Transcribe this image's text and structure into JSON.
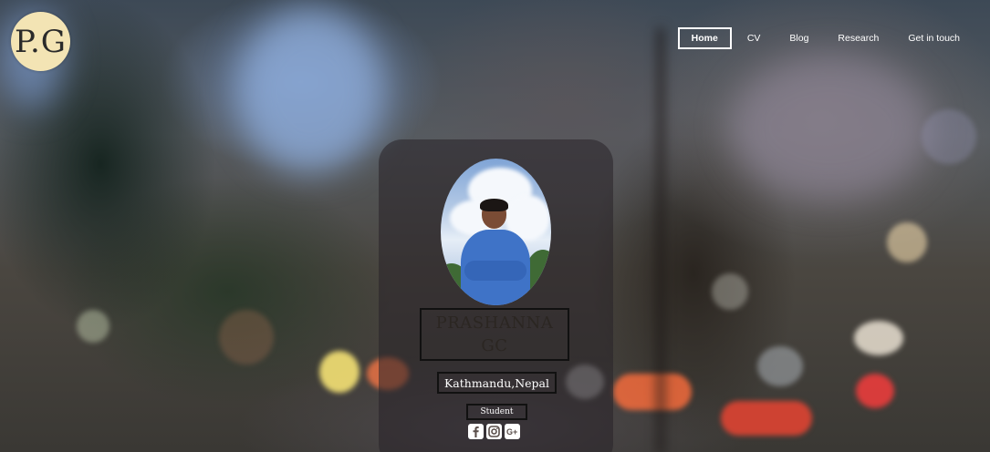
{
  "logo": {
    "text": "P.G"
  },
  "nav": {
    "items": [
      {
        "label": "Home",
        "active": true
      },
      {
        "label": "CV",
        "active": false
      },
      {
        "label": "Blog",
        "active": false
      },
      {
        "label": "Research",
        "active": false
      },
      {
        "label": "Get in touch",
        "active": false
      }
    ]
  },
  "profile": {
    "name_line1": "PRASHANNA",
    "name_line2": "GC",
    "location": "Kathmandu,Nepal",
    "role": "Student"
  },
  "socials": [
    {
      "icon": "facebook-icon",
      "glyph": "f"
    },
    {
      "icon": "instagram-icon",
      "glyph": "◎"
    },
    {
      "icon": "google-plus-icon",
      "glyph": "G+"
    }
  ],
  "colors": {
    "logo_bg": "#f3e4b4",
    "nav_text": "#ffffff",
    "card_bg": "rgba(40,35,40,0.55)",
    "name_text": "#2b2622"
  }
}
